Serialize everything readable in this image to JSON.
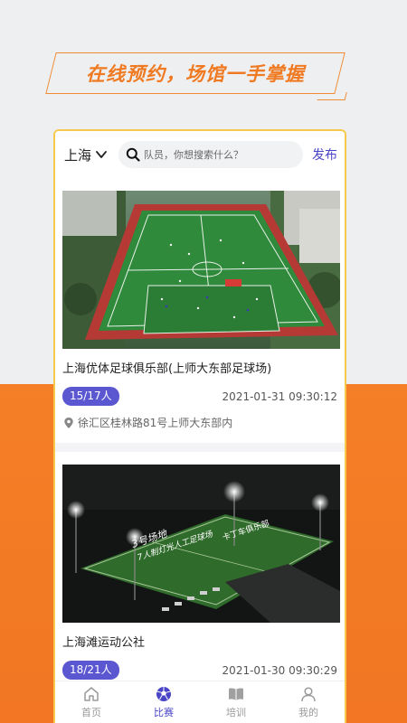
{
  "banner": {
    "text": "在线预约，场馆一手掌握"
  },
  "topbar": {
    "city": "上海",
    "search_placeholder": "队员，你想搜索什么？",
    "publish_label": "发布"
  },
  "cards": [
    {
      "title": "上海优体足球俱乐部(上师大东部足球场)",
      "count": "15/17人",
      "time": "2021-01-31 09:30:12",
      "address": "徐汇区桂林路81号上师大东部内"
    },
    {
      "title": "上海滩运动公社",
      "count": "18/21人",
      "time": "2021-01-30 09:30:29",
      "overlay_title": "3号场地",
      "overlay_sub": "7人制灯光人工足球场",
      "overlay_club": "卡丁车俱乐部"
    }
  ],
  "tabs": [
    {
      "label": "首页",
      "icon": "home-icon",
      "active": false
    },
    {
      "label": "比赛",
      "icon": "soccer-ball-icon",
      "active": true
    },
    {
      "label": "培训",
      "icon": "book-icon",
      "active": false
    },
    {
      "label": "我的",
      "icon": "person-icon",
      "active": false
    }
  ],
  "colors": {
    "accent": "#4a45c6",
    "orange": "#f47f26",
    "badge": "#5b57d1",
    "frame": "#f6c94c"
  }
}
